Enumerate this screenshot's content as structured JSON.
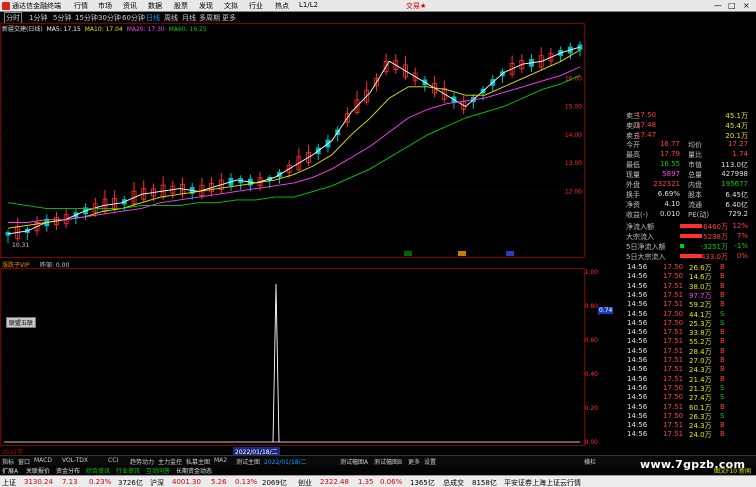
{
  "app": {
    "title": "通达信金融终端",
    "menu": [
      "行情",
      "市场",
      "资讯",
      "数据",
      "股票",
      "发现",
      "文拟",
      "行业",
      "热点",
      "L1/L2"
    ],
    "trade_label": "交易★",
    "win_buttons": [
      "—",
      "□",
      "×"
    ]
  },
  "period_bar": {
    "items": [
      "分时",
      "1分钟",
      "5分钟",
      "15分钟",
      "30分钟",
      "60分钟",
      "日线",
      "周线",
      "月线",
      "多周期",
      "更多"
    ],
    "active": "日线"
  },
  "stock": {
    "name": "新疆交建(日线)",
    "ma_legend": [
      {
        "label": "MA5: 17.15",
        "color": "#ffffff"
      },
      {
        "label": "MA10: 17.04",
        "color": "#e8e800"
      },
      {
        "label": "MA20: 17.30",
        "color": "#ff40ff"
      },
      {
        "label": "MA60: 16.25",
        "color": "#00d000"
      }
    ],
    "low_label": "10.31",
    "right_axis_price": [
      "16.00",
      "15.00",
      "14.00",
      "13.00",
      "12.00"
    ]
  },
  "chart_data": {
    "type": "candlestick",
    "series": [
      {
        "name": "MA5",
        "values": [
          10.5,
          10.6,
          10.9,
          11.0,
          11.3,
          11.5,
          11.6,
          11.9,
          12.0,
          12.1,
          12.0,
          12.2,
          12.4,
          12.3,
          12.5,
          12.9,
          13.3,
          13.8,
          14.8,
          15.5,
          16.6,
          16.2,
          15.8,
          15.4,
          15.0,
          15.6,
          16.2,
          16.5,
          16.6,
          16.9,
          17.1
        ]
      },
      {
        "name": "MA10",
        "values": [
          10.7,
          10.8,
          10.9,
          11.0,
          11.1,
          11.3,
          11.4,
          11.6,
          11.8,
          11.9,
          12.0,
          12.1,
          12.2,
          12.3,
          12.4,
          12.6,
          12.9,
          13.3,
          14.0,
          14.6,
          15.3,
          15.7,
          15.7,
          15.6,
          15.4,
          15.4,
          15.7,
          16.0,
          16.3,
          16.6,
          17.0
        ]
      },
      {
        "name": "MA20",
        "values": [
          10.9,
          10.9,
          11.0,
          11.0,
          11.1,
          11.2,
          11.3,
          11.4,
          11.6,
          11.7,
          11.8,
          11.9,
          12.0,
          12.1,
          12.2,
          12.3,
          12.5,
          12.8,
          13.2,
          13.6,
          14.1,
          14.6,
          14.9,
          15.1,
          15.2,
          15.3,
          15.5,
          15.7,
          15.9,
          16.1,
          16.4
        ]
      },
      {
        "name": "MA60",
        "values": [
          11.6,
          11.5,
          11.4,
          11.4,
          11.4,
          11.4,
          11.4,
          11.5,
          11.5,
          11.5,
          11.6,
          11.6,
          11.7,
          11.7,
          11.8,
          11.8,
          12.0,
          12.2,
          12.5,
          12.8,
          13.2,
          13.6,
          14.0,
          14.3,
          14.6,
          14.8,
          15.0,
          15.3,
          15.6,
          15.8,
          16.1
        ]
      }
    ],
    "ylim": [
      10,
      17.6
    ],
    "y_ticks": [
      "16.00",
      "15.00",
      "14.00",
      "13.00",
      "12.00"
    ]
  },
  "sub_chart": {
    "title": "涨跌子VIP",
    "subtitle": "昨邹: 0.00",
    "tooltip_label": "联盟五联",
    "axis": [
      "1.00",
      "0.80",
      "0.60",
      "0.40",
      "0.20",
      "0.00"
    ],
    "marker": "0.74",
    "spike_fraction": 0.93
  },
  "date_axis": {
    "start": "2021年",
    "cursor": "2022/01/18/二"
  },
  "quote": {
    "rows": [
      {
        "lbl": "卖三",
        "v1": "17.50",
        "v1c": "red",
        "v2": "45.1万",
        "v2c": "yellow"
      },
      {
        "lbl": "卖四",
        "v1": "17.48",
        "v1c": "red",
        "v2": "45.4万",
        "v2c": "yellow"
      },
      {
        "lbl": "卖五",
        "v1": "17.47",
        "v1c": "red",
        "v2": "20.1万",
        "v2c": "yellow"
      }
    ],
    "stats": [
      {
        "l1": "今开",
        "v1": "16.77",
        "c1": "red",
        "l2": "均价",
        "v2": "17.27",
        "c2": "red"
      },
      {
        "l1": "最高",
        "v1": "17.79",
        "c1": "red",
        "l2": "量比",
        "v2": "1.74",
        "c2": "red"
      },
      {
        "l1": "最低",
        "v1": "16.55",
        "c1": "green",
        "l2": "市值",
        "v2": "113.0亿",
        "c2": "white"
      },
      {
        "l1": "现量",
        "v1": "5897",
        "c1": "magenta",
        "l2": "总量",
        "v2": "427998",
        "c2": "white"
      },
      {
        "l1": "外盘",
        "v1": "232321",
        "c1": "red",
        "l2": "内盘",
        "v2": "195677",
        "c2": "green"
      },
      {
        "l1": "换手",
        "v1": "6.69%",
        "c1": "white",
        "l2": "股本",
        "v2": "6.45亿",
        "c2": "white"
      },
      {
        "l1": "净资",
        "v1": "4.10",
        "c1": "white",
        "l2": "流通",
        "v2": "6.40亿",
        "c2": "white"
      },
      {
        "l1": "收益(-)",
        "v1": "0.010",
        "c1": "white",
        "l2": "PE(动)",
        "v2": "729.2",
        "c2": "white"
      }
    ],
    "flows": [
      {
        "lbl": "净流入额",
        "bar": "#ff3030",
        "v": "6460万",
        "vc": "red",
        "p": "12%",
        "pc": "red"
      },
      {
        "lbl": "大宗流入",
        "bar": "#ff3030",
        "v": "5238万",
        "vc": "red",
        "p": "7%",
        "pc": "red"
      },
      {
        "lbl": "5日净流入额",
        "bar": "#00d000",
        "v": "-3251万",
        "vc": "green",
        "p": "-1%",
        "pc": "green"
      },
      {
        "lbl": "5日大宗流入",
        "bar": "#ff3030",
        "v": "433.0万",
        "vc": "red",
        "p": "0%",
        "pc": "red"
      }
    ]
  },
  "trades": [
    {
      "t": "14:56",
      "p": "17.50",
      "pc": "red",
      "v": "26.6万",
      "vc": "yellow",
      "bs": "B",
      "bsc": "red"
    },
    {
      "t": "14:56",
      "p": "17.50",
      "pc": "red",
      "v": "14.6万",
      "vc": "yellow",
      "bs": "B",
      "bsc": "red"
    },
    {
      "t": "14:56",
      "p": "17.51",
      "pc": "red",
      "v": "38.0万",
      "vc": "yellow",
      "bs": "B",
      "bsc": "red"
    },
    {
      "t": "14:56",
      "p": "17.51",
      "pc": "red",
      "v": "97.7万",
      "vc": "magenta",
      "bs": "B",
      "bsc": "red"
    },
    {
      "t": "14:56",
      "p": "17.51",
      "pc": "red",
      "v": "59.2万",
      "vc": "yellow",
      "bs": "B",
      "bsc": "red"
    },
    {
      "t": "14:56",
      "p": "17.50",
      "pc": "red",
      "v": "44.1万",
      "vc": "yellow",
      "bs": "S",
      "bsc": "green"
    },
    {
      "t": "14:56",
      "p": "17.50",
      "pc": "red",
      "v": "25.3万",
      "vc": "yellow",
      "bs": "S",
      "bsc": "green"
    },
    {
      "t": "14:56",
      "p": "17.51",
      "pc": "red",
      "v": "33.8万",
      "vc": "yellow",
      "bs": "B",
      "bsc": "red"
    },
    {
      "t": "14:56",
      "p": "17.51",
      "pc": "red",
      "v": "55.2万",
      "vc": "yellow",
      "bs": "B",
      "bsc": "red"
    },
    {
      "t": "14:56",
      "p": "17.51",
      "pc": "red",
      "v": "28.4万",
      "vc": "yellow",
      "bs": "B",
      "bsc": "red"
    },
    {
      "t": "14:56",
      "p": "17.51",
      "pc": "red",
      "v": "27.0万",
      "vc": "yellow",
      "bs": "B",
      "bsc": "red"
    },
    {
      "t": "14:56",
      "p": "17.51",
      "pc": "red",
      "v": "24.3万",
      "vc": "yellow",
      "bs": "B",
      "bsc": "red"
    },
    {
      "t": "14:56",
      "p": "17.51",
      "pc": "red",
      "v": "21.4万",
      "vc": "yellow",
      "bs": "B",
      "bsc": "red"
    },
    {
      "t": "14:56",
      "p": "17.50",
      "pc": "red",
      "v": "21.3万",
      "vc": "yellow",
      "bs": "S",
      "bsc": "green"
    },
    {
      "t": "14:56",
      "p": "17.50",
      "pc": "red",
      "v": "27.4万",
      "vc": "yellow",
      "bs": "S",
      "bsc": "green"
    },
    {
      "t": "14:56",
      "p": "17.51",
      "pc": "red",
      "v": "60.1万",
      "vc": "yellow",
      "bs": "B",
      "bsc": "red"
    },
    {
      "t": "14:56",
      "p": "17.50",
      "pc": "red",
      "v": "26.3万",
      "vc": "yellow",
      "bs": "S",
      "bsc": "green"
    },
    {
      "t": "14:56",
      "p": "17.51",
      "pc": "red",
      "v": "24.3万",
      "vc": "yellow",
      "bs": "B",
      "bsc": "red"
    },
    {
      "t": "14:56",
      "p": "17.51",
      "pc": "red",
      "v": "24.0万",
      "vc": "yellow",
      "bs": "B",
      "bsc": "red"
    }
  ],
  "tabs": [
    "指标",
    "窗口",
    "MACD",
    "VOL-TDX",
    "CCI",
    "趋势动力",
    "主力监控",
    "私募主图",
    "MA2",
    "测试主图",
    "2022/01/18/二",
    "测试幅图A",
    "测试幅图B",
    "更多",
    "设置"
  ],
  "tabs_right": "横栏",
  "news": [
    {
      "text": "扩展A",
      "color": "#e0e0e0"
    },
    {
      "text": "关联报价",
      "color": "#e0e0e0"
    },
    {
      "text": "资金分布",
      "color": "#e0e0e0"
    },
    {
      "text": "综合资讯",
      "color": "#00d000"
    },
    {
      "text": "行业资讯",
      "color": "#00d000"
    },
    {
      "text": "互动问答",
      "color": "#00d000"
    },
    {
      "text": "长期资金动态",
      "color": "#e0e0e0"
    }
  ],
  "news_right": "图文F10 新闻",
  "status": [
    {
      "text": "上证",
      "c": ""
    },
    {
      "text": "3130.24",
      "c": "red"
    },
    {
      "text": "7.13",
      "c": "red"
    },
    {
      "text": "0.23%",
      "c": "red"
    },
    {
      "text": "3726亿",
      "c": ""
    },
    {
      "text": "沪深",
      "c": ""
    },
    {
      "text": "4001.30",
      "c": "red"
    },
    {
      "text": "5.26",
      "c": "red"
    },
    {
      "text": "0.13%",
      "c": "red"
    },
    {
      "text": "2069亿",
      "c": ""
    },
    {
      "text": "创业",
      "c": ""
    },
    {
      "text": "2322.48",
      "c": "red"
    },
    {
      "text": "1.35",
      "c": "red"
    },
    {
      "text": "0.06%",
      "c": "red"
    },
    {
      "text": "1365亿",
      "c": ""
    },
    {
      "text": "总成交",
      "c": ""
    },
    {
      "text": "8158亿",
      "c": ""
    },
    {
      "text": "平安证券上海上证云行情",
      "c": ""
    }
  ],
  "watermark": "www.7gpzb.com",
  "colors": {
    "up": "#ff3030",
    "down": "#00c0c0",
    "ma5": "#ffffff",
    "ma10": "#e8e800",
    "ma20": "#ff40ff",
    "ma60": "#00d000"
  }
}
